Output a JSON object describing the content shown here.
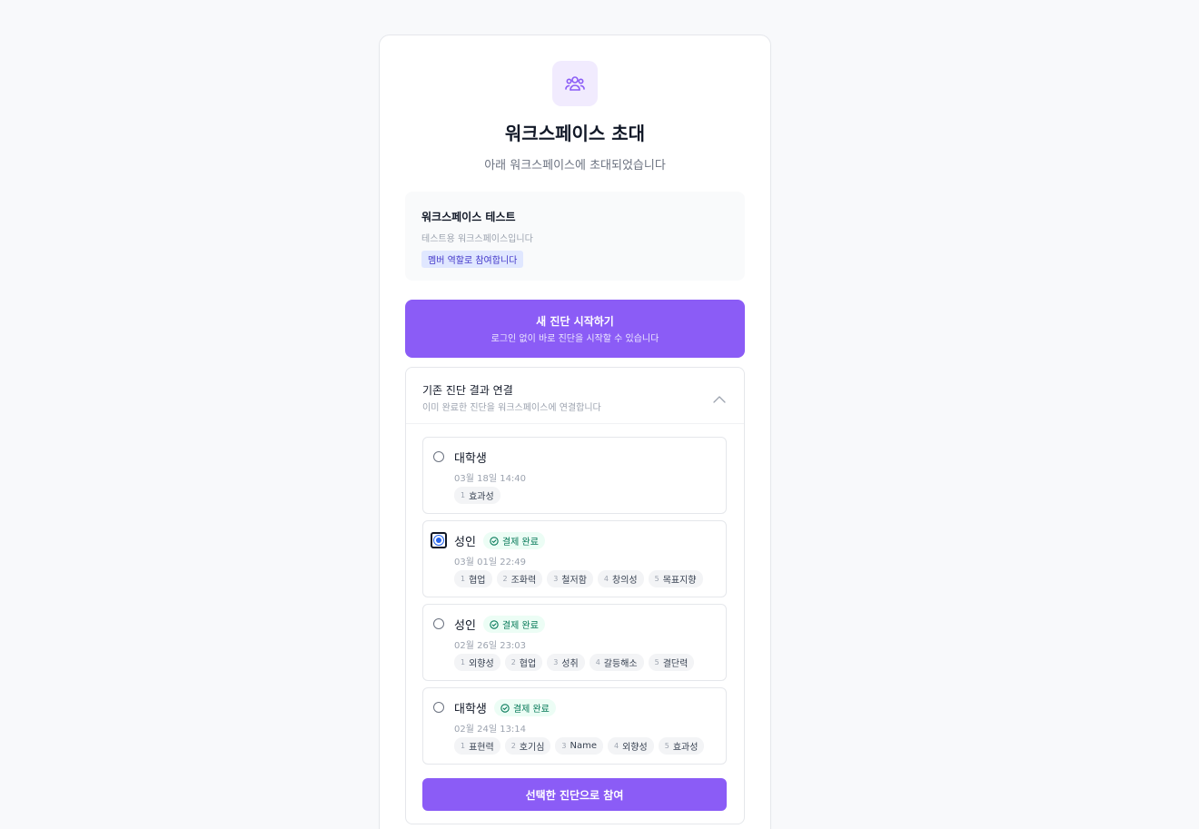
{
  "header": {
    "title": "워크스페이스 초대",
    "subtitle": "아래 워크스페이스에 초대되었습니다",
    "icon": "users-group-icon"
  },
  "workspace": {
    "name": "워크스페이스 테스트",
    "description": "테스트용 워크스페이스입니다",
    "role_badge": "멤버 역할로 참여합니다"
  },
  "start_button": {
    "label": "새 진단 시작하기",
    "sublabel": "로그인 없이 바로 진단을 시작할 수 있습니다"
  },
  "link_panel": {
    "title": "기존 진단 결과 연결",
    "description": "이미 완료한 진단을 워크스페이스에 연결합니다",
    "expanded": true,
    "items": [
      {
        "name": "대학생",
        "paid": false,
        "badge": "",
        "date": "03월 18일 14:40",
        "selected": false,
        "tags": [
          {
            "n": "1",
            "label": "효과성"
          }
        ]
      },
      {
        "name": "성인",
        "paid": true,
        "badge": "결제 완료",
        "date": "03월 01일 22:49",
        "selected": true,
        "tags": [
          {
            "n": "1",
            "label": "협업"
          },
          {
            "n": "2",
            "label": "조화력"
          },
          {
            "n": "3",
            "label": "철저함"
          },
          {
            "n": "4",
            "label": "창의성"
          },
          {
            "n": "5",
            "label": "목표지향"
          }
        ]
      },
      {
        "name": "성인",
        "paid": true,
        "badge": "결제 완료",
        "date": "02월 26일 23:03",
        "selected": false,
        "tags": [
          {
            "n": "1",
            "label": "외향성"
          },
          {
            "n": "2",
            "label": "협업"
          },
          {
            "n": "3",
            "label": "성취"
          },
          {
            "n": "4",
            "label": "갈등해소"
          },
          {
            "n": "5",
            "label": "결단력"
          }
        ]
      },
      {
        "name": "대학생",
        "paid": true,
        "badge": "결제 완료",
        "date": "02월 24일 13:14",
        "selected": false,
        "tags": [
          {
            "n": "1",
            "label": "표현력"
          },
          {
            "n": "2",
            "label": "호기심"
          },
          {
            "n": "3",
            "label": "Name"
          },
          {
            "n": "4",
            "label": "외향성"
          },
          {
            "n": "5",
            "label": "효과성"
          }
        ]
      }
    ],
    "join_button": "선택한 진단으로 참여"
  },
  "colors": {
    "accent": "#8b5cf6",
    "paid_badge_bg": "#ecfdf5",
    "paid_badge_text": "#047857",
    "role_badge_bg": "#e0e7ff"
  }
}
